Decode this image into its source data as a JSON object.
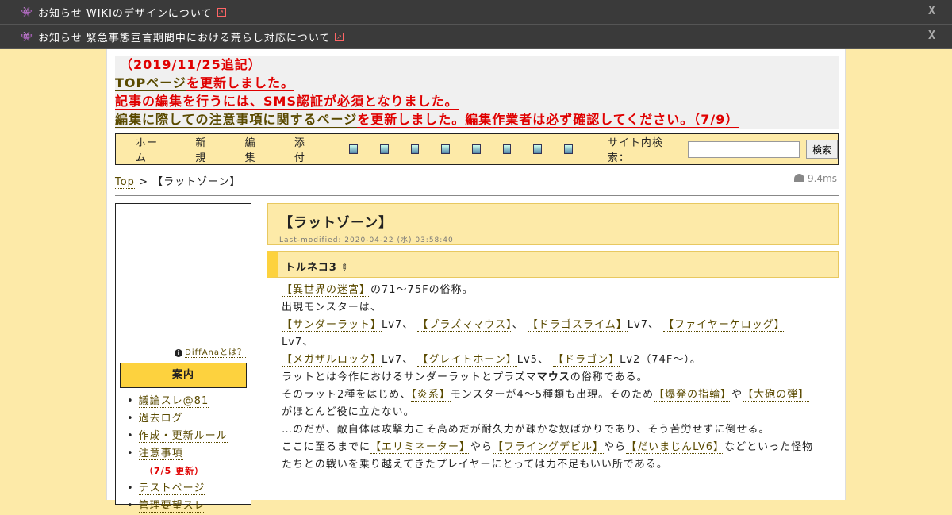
{
  "notices": [
    {
      "text": "お知らせ WIKIのデザインについて",
      "close": "X"
    },
    {
      "text": "お知らせ 緊急事態宣言期間中における荒らし対応について",
      "close": "X"
    }
  ],
  "announce": {
    "date": "（2019/11/25追記）",
    "l2_link": "TOPページ",
    "l2_rest": "を更新しました。",
    "l3": "記事の編集を行うには、SMS認証が必須となりました。",
    "l4_link": "編集に際しての注意事項に関するページ",
    "l4_rest": "を更新しました。編集作業者は必ず確認してください。（7/9）"
  },
  "toolbar": {
    "menu": [
      "ホーム",
      "新規",
      "編集",
      "添付"
    ],
    "icons": [
      "diff-icon",
      "history-icon",
      "delete-icon",
      "save-icon",
      "lock-icon",
      "copy-icon",
      "page-icon",
      "help-icon"
    ],
    "search_label": "サイト内検索：",
    "search_placeholder": "",
    "search_button": "検索"
  },
  "breadcrumb": {
    "top": "Top",
    "sep": ">",
    "current": "【ラットゾーン】"
  },
  "timing": "9.4ms",
  "sidebar": {
    "diffana": "DiffAnaとは？",
    "heading": "案内",
    "items": [
      "議論スレ@81",
      "過去ログ",
      "作成・更新ルール",
      "注意事項",
      "テストページ",
      "管理要望スレ"
    ],
    "update_note": "（7/5 更新）"
  },
  "page": {
    "title": "【ラットゾーン】",
    "last_modified": "Last-modified: 2020-04-22 (水) 03:58:40",
    "section": "トルネコ3",
    "lines": {
      "l1_link": "【異世界の迷宮】",
      "l1_rest": "の71～75Fの俗称。",
      "l2": "出現モンスターは、",
      "m1": "【サンダーラット】",
      "m2": "【プラズママウス】",
      "m3": "【ドラゴスライム】",
      "m4": "【ファイヤーケロッグ】",
      "m5": "【メガザルロック】",
      "m6": "【グレイトホーン】",
      "m7": "【ドラゴン】",
      "lv7a": "Lv7、",
      "lv7b": "、",
      "lv7c": "Lv7、",
      "lv7d": "Lv7、",
      "lv7e": "Lv7、",
      "lv5": "Lv5、",
      "lv2": "Lv2（74F～）。",
      "l5a": "ラットとは今作におけるサンダーラットとプラズマ",
      "l5b": "マウス",
      "l5c": "の俗称である。",
      "l6a": "そのラット2種をはじめ、",
      "l6link": "【炎系】",
      "l6b": "モンスターが4～5種類も出現。そのため",
      "l6link2": "【爆発の指輪】",
      "l6c": "や",
      "l6link3": "【大砲の弾】",
      "l6d": "がほとんど役に立たない。",
      "l7": "…のだが、敵自体は攻撃力こそ高めだが耐久力が疎かな奴ばかりであり、そう苦労せずに倒せる。",
      "l8a": "ここに至るまでに",
      "l8link1": "【エリミネーター】",
      "l8b": "やら",
      "l8link2": "【フライングデビル】",
      "l8c": "やら",
      "l8link3": "【だいまじんLV6】",
      "l8d": "などといった怪物たちとの戦いを乗り越えてきたプレイヤーにとっては力不足もいい所である。"
    }
  }
}
